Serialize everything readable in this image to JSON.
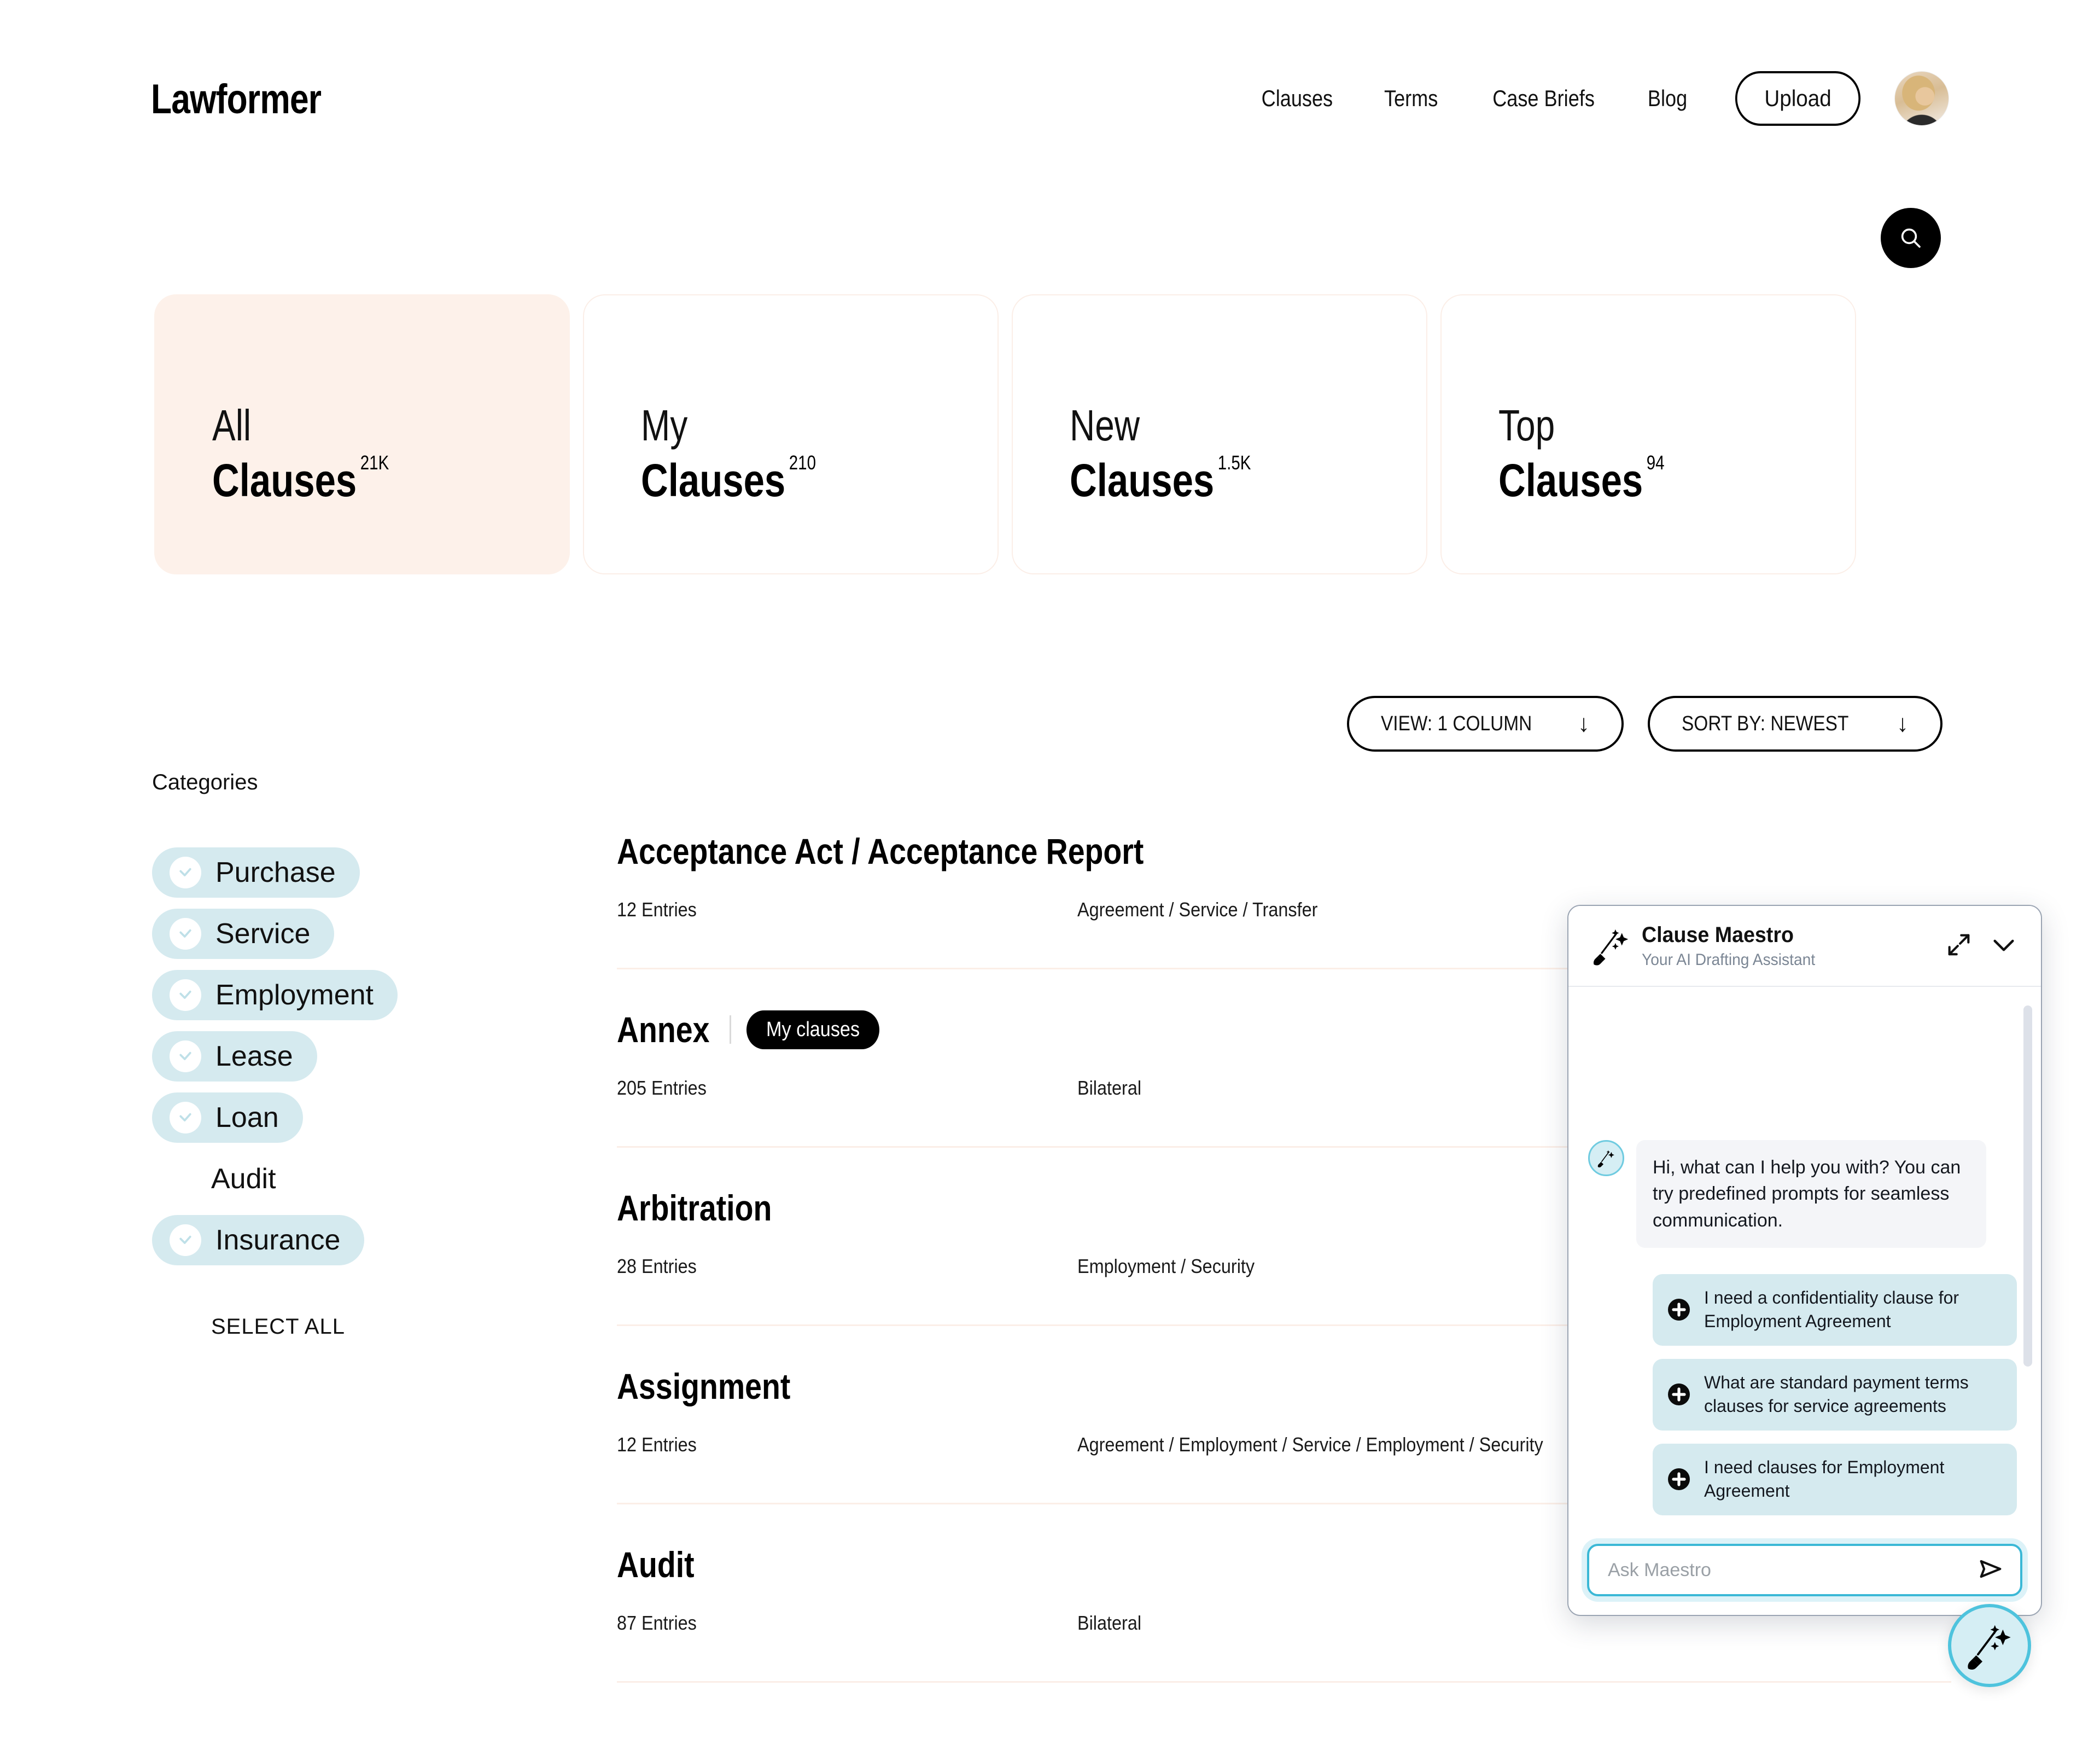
{
  "header": {
    "logo": "Lawformer",
    "nav": [
      {
        "label": "Clauses"
      },
      {
        "label": "Terms"
      },
      {
        "label": "Case Briefs"
      },
      {
        "label": "Blog"
      }
    ],
    "upload_label": "Upload",
    "avatar_alt": "User avatar"
  },
  "search": {
    "icon": "search-icon"
  },
  "cards": [
    {
      "line1": "All",
      "line2": "Clauses",
      "count": "21K",
      "active": true
    },
    {
      "line1": "My",
      "line2": "Clauses",
      "count": "210",
      "active": false
    },
    {
      "line1": "New",
      "line2": "Clauses",
      "count": "1.5K",
      "active": false
    },
    {
      "line1": "Top",
      "line2": "Clauses",
      "count": "94",
      "active": false
    }
  ],
  "controls": {
    "view": {
      "label": "VIEW: 1 COLUMN",
      "arrow": "↓"
    },
    "sort": {
      "label": "SORT BY: NEWEST",
      "arrow": "↓"
    }
  },
  "sidebar": {
    "title": "Categories",
    "select_all": "SELECT ALL",
    "items": [
      {
        "label": "Purchase",
        "selected": true
      },
      {
        "label": "Service",
        "selected": true
      },
      {
        "label": "Employment",
        "selected": true
      },
      {
        "label": "Lease",
        "selected": true
      },
      {
        "label": "Loan",
        "selected": true
      },
      {
        "label": "Audit",
        "selected": false
      },
      {
        "label": "Insurance",
        "selected": true
      }
    ]
  },
  "clauses": [
    {
      "title": "Acceptance Act / Acceptance Report",
      "badge": "",
      "entries": "12 Entries",
      "tags": "Agreement / Service / Transfer"
    },
    {
      "title": "Annex",
      "badge": "My clauses",
      "entries": "205 Entries",
      "tags": "Bilateral"
    },
    {
      "title": "Arbitration",
      "badge": "",
      "entries": "28 Entries",
      "tags": "Employment / Security"
    },
    {
      "title": "Assignment",
      "badge": "",
      "entries": "12 Entries",
      "tags": "Agreement / Employment / Service / Employment / Security"
    },
    {
      "title": "Audit",
      "badge": "",
      "entries": "87 Entries",
      "tags": "Bilateral"
    }
  ],
  "chat": {
    "title": "Clause Maestro",
    "subtitle": "Your AI Drafting Assistant",
    "expand_icon": "expand-icon",
    "collapse_icon": "chevron-down-icon",
    "message": "Hi, what can I help you with? You can try predefined prompts for seamless communication.",
    "suggestions": [
      "I need a confidentiality clause for Employment Agreement",
      "What are standard payment terms clauses for service agreements",
      "I need clauses for Employment Agreement"
    ],
    "input_placeholder": "Ask Maestro",
    "input_value": "",
    "send_icon": "send-icon"
  },
  "fab": {
    "icon": "maestro-wand-icon"
  },
  "colors": {
    "accent_peach": "#fdf1ea",
    "accent_blue": "#d5eaef",
    "cyan": "#3bb8d6",
    "black": "#000000",
    "divider": "#fbeee7"
  }
}
